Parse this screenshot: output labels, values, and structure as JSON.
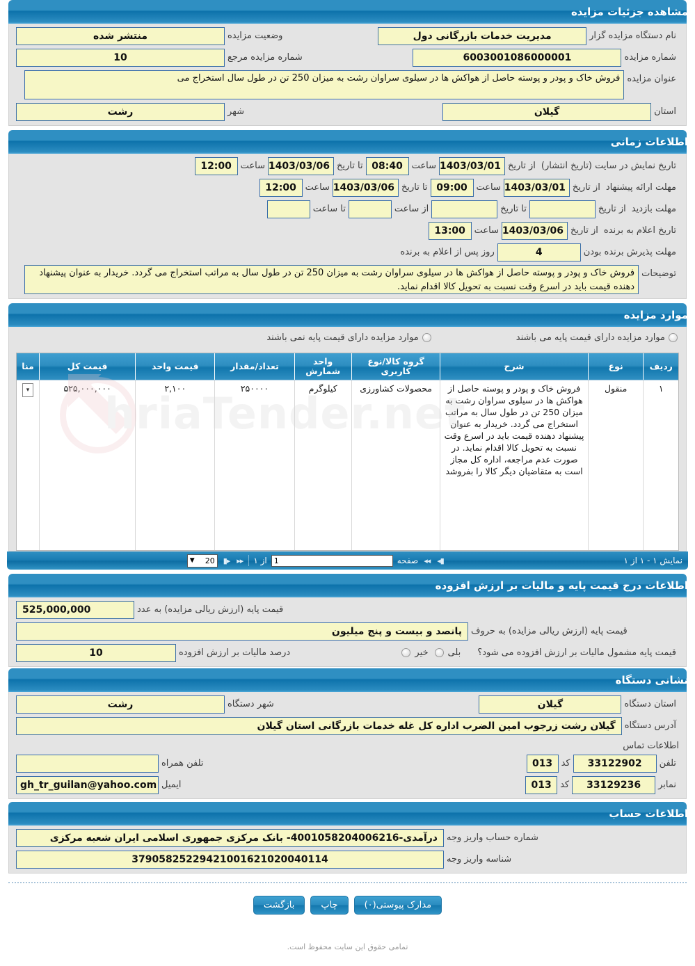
{
  "header": {
    "title": "مشاهده جزئیات مزایده"
  },
  "details": {
    "org_label": "نام دستگاه مزایده گزار",
    "org_value": "مدیریت خدمات بازرگانی دول",
    "status_label": "وضعیت مزایده",
    "status_value": "منتشر شده",
    "auction_no_label": "شماره مزایده",
    "auction_no_value": "6003001086000001",
    "ref_no_label": "شماره مزایده مرجع",
    "ref_no_value": "10",
    "title_label": "عنوان مزایده",
    "title_value": "فروش خاک و پودر و پوسته حاصل از هواکش ها در سیلوی سراوان رشت به میزان 250 تن در طول سال استخراج می",
    "province_label": "استان",
    "province_value": "گیلان",
    "city_label": "شهر",
    "city_value": "رشت"
  },
  "timing": {
    "section_title": "اطلاعات زمانی",
    "publish_label": "تاریخ نمایش در سایت (تاریخ انتشار)",
    "publish_from_label": "از تاریخ",
    "publish_from": "1403/03/01",
    "publish_from_time_label": "ساعت",
    "publish_from_time": "08:40",
    "publish_to_label": "تا تاریخ",
    "publish_to": "1403/03/06",
    "publish_to_time_label": "ساعت",
    "publish_to_time": "12:00",
    "offer_label": "مهلت ارائه پیشنهاد",
    "offer_from_label": "از تاریخ",
    "offer_from": "1403/03/01",
    "offer_from_time_label": "ساعت",
    "offer_from_time": "09:00",
    "offer_to_label": "تا تاریخ",
    "offer_to": "1403/03/06",
    "offer_to_time_label": "ساعت",
    "offer_to_time": "12:00",
    "visit_label": "مهلت بازدید",
    "visit_from_label": "از تاریخ",
    "visit_from": "",
    "visit_from_time_label": "از ساعت",
    "visit_from_time": "",
    "visit_to_label": "تا تاریخ",
    "visit_to": "",
    "visit_to_time_label": "تا ساعت",
    "visit_to_time": "",
    "winner_label": "تاریخ اعلام به برنده",
    "winner_from_label": "از تاریخ",
    "winner_from": "1403/03/06",
    "winner_time_label": "ساعت",
    "winner_time": "13:00",
    "accept_label": "مهلت پذیرش برنده بودن",
    "accept_days": "4",
    "accept_suffix": "روز پس از اعلام به برنده",
    "notes_label": "توضیحات",
    "notes_value": "فروش خاک و پودر و پوسته حاصل از هواکش ها در سیلوی سراوان رشت به میزان 250 تن در طول سال به مراتب استخراج می گردد. خریدار به عنوان پیشنهاد دهنده قیمت باید در اسرع وقت نسبت به تحویل کالا اقدام نماید."
  },
  "items": {
    "section_title": "موارد مزایده",
    "radio_with_base": "موارد مزایده دارای قیمت پایه می باشند",
    "radio_without_base": "موارد مزایده دارای قیمت پایه نمی باشند",
    "columns": [
      "ردیف",
      "نوع",
      "شرح",
      "گروه کالا/نوع کاربری",
      "واحد شمارش",
      "تعداد/مقدار",
      "قیمت واحد",
      "قیمت کل",
      "منا"
    ],
    "rows": [
      {
        "radif": "۱",
        "noe": "منقول",
        "sharh": "فروش خاک و پودر و پوسته حاصل از هواکش ها در سیلوی سراوان رشت به میزان 250 تن در طول سال به مراتب استخراج می گردد. خریدار به عنوان پیشنهاد دهنده قیمت باید در اسرع وقت نسبت به تحویل کالا اقدام نماید. در صورت عدم مراجعه، اداره کل مجاز است به متقاضیان دیگر کالا را بفروشد",
        "group": "محصولات کشاورزی",
        "unit": "کیلوگرم",
        "qty": "۲۵۰۰۰۰",
        "unit_price": "۲,۱۰۰",
        "total_price": "۵۲۵,۰۰۰,۰۰۰",
        "last": ""
      }
    ],
    "pager": {
      "summary": "نمایش ۱ - ۱ از ۱",
      "page_label": "صفحه",
      "page_value": "1",
      "of_label": "از ۱",
      "page_size": "20",
      "first_icon": "first-page-icon",
      "prev_icon": "prev-page-icon",
      "next_icon": "next-page-icon",
      "last_icon": "last-page-icon",
      "chevron_icon": "chevron-down-icon"
    }
  },
  "pricing": {
    "section_title": "اطلاعات درج قیمت پایه و مالیات بر ارزش افزوده",
    "base_num_label": "قیمت پایه (ارزش ریالی مزایده) به عدد",
    "base_num_value": "525,000,000",
    "base_text_label": "قیمت پایه (ارزش ریالی مزایده) به حروف",
    "base_text_value": "پانصد و بیست و پنج میلیون",
    "vat_question": "قیمت پایه مشمول مالیات بر ارزش افزوده می شود؟",
    "vat_yes": "بلی",
    "vat_no": "خیر",
    "vat_percent_label": "درصد مالیات بر ارزش افزوده",
    "vat_percent_value": "10"
  },
  "address": {
    "section_title": "نشانی دستگاه",
    "province_label": "استان دستگاه",
    "province_value": "گیلان",
    "city_label": "شهر دستگاه",
    "city_value": "رشت",
    "address_label": "آدرس دستگاه",
    "address_value": "گیلان  رشت زرجوب امین الضرب اداره کل غله خدمات بازرگانی استان گیلان",
    "contact_title": "اطلاعات تماس",
    "phone_label": "تلفن",
    "phone_value": "33122902",
    "phone_code_label": "کد",
    "phone_code": "013",
    "mobile_label": "تلفن همراه",
    "mobile_value": "",
    "fax_label": "نمابر",
    "fax_value": "33129236",
    "fax_code_label": "کد",
    "fax_code": "013",
    "email_label": "ایمیل",
    "email_value": "gh_tr_guilan@yahoo.com"
  },
  "account": {
    "section_title": "اطلاعات حساب",
    "account_no_label": "شماره حساب واریز وجه",
    "account_no_value": "درآمدی-4001058204006216- بانک مرکزی جمهوری اسلامی ایران شعبه مرکزی",
    "shenase_label": "شناسه واریز وجه",
    "shenase_value": "37905825229421001621020040114"
  },
  "actions": {
    "attachments": "مدارک پیوستی(۰)",
    "print": "چاپ",
    "back": "بازگشت"
  },
  "footer": {
    "text": "تمامی حقوق این سایت محفوظ است."
  },
  "watermark": {
    "text": "hriaTender.net"
  },
  "colors": {
    "bar_blue": "#2f8fc2",
    "field_yellow": "#f7f7c6",
    "field_border": "#3a6ea8",
    "panel_bg": "#e4e4e4"
  }
}
